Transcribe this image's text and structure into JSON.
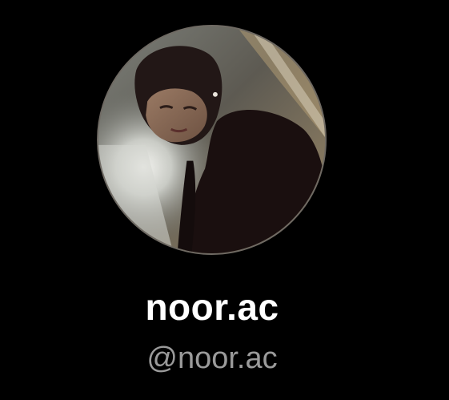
{
  "profile": {
    "display_name": "noor.ac",
    "handle": "@noor.ac",
    "avatar_icon": "profile-photo"
  },
  "colors": {
    "background": "#000000",
    "display_name": "#ffffff",
    "handle": "#9a9a9a"
  }
}
